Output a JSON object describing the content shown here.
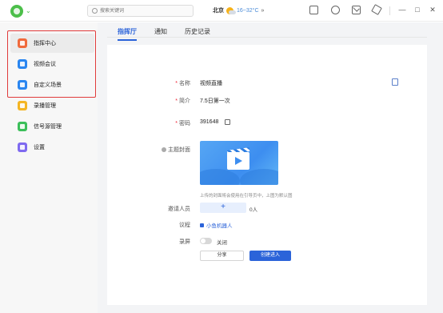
{
  "topbar": {
    "search_placeholder": "搜索关键词",
    "weather": {
      "city": "北京",
      "temp": "16~32°C",
      "more": "»"
    },
    "window": {
      "minimize": "—",
      "maximize": "□",
      "close": "✕"
    }
  },
  "sidebar": {
    "items": [
      {
        "label": "指挥中心",
        "color": "#f06a3c",
        "active": true
      },
      {
        "label": "视频会议",
        "color": "#2a86f0"
      },
      {
        "label": "自定义场景",
        "color": "#2a86f0"
      },
      {
        "label": "录播管理",
        "color": "#f4b523"
      },
      {
        "label": "信号源管理",
        "color": "#3cbf5a"
      },
      {
        "label": "设置",
        "color": "#7f6af0"
      }
    ]
  },
  "tabs": [
    {
      "label": "指挥厅",
      "active": true
    },
    {
      "label": "通知"
    },
    {
      "label": "历史记录"
    }
  ],
  "form": {
    "name_label": "名称",
    "name_value": "视频直播",
    "intro_label": "简介",
    "intro_value": "7.5日第一次",
    "password_label": "密码",
    "password_value": "391648",
    "cover_label": "主题封面",
    "cover_hint": "上传的封面将会使用在引导页中，上图为默认图",
    "invite_label": "邀请人员",
    "invite_plus": "+",
    "invite_count": "0人",
    "agenda_label": "议程",
    "agenda_value": "小鱼机器人",
    "record_label": "录屏",
    "record_state": "关闭",
    "share_button": "分享",
    "create_button": "创建进入"
  },
  "colors": {
    "accent": "#2b63d9",
    "highlight_box": "#e03b3b"
  }
}
